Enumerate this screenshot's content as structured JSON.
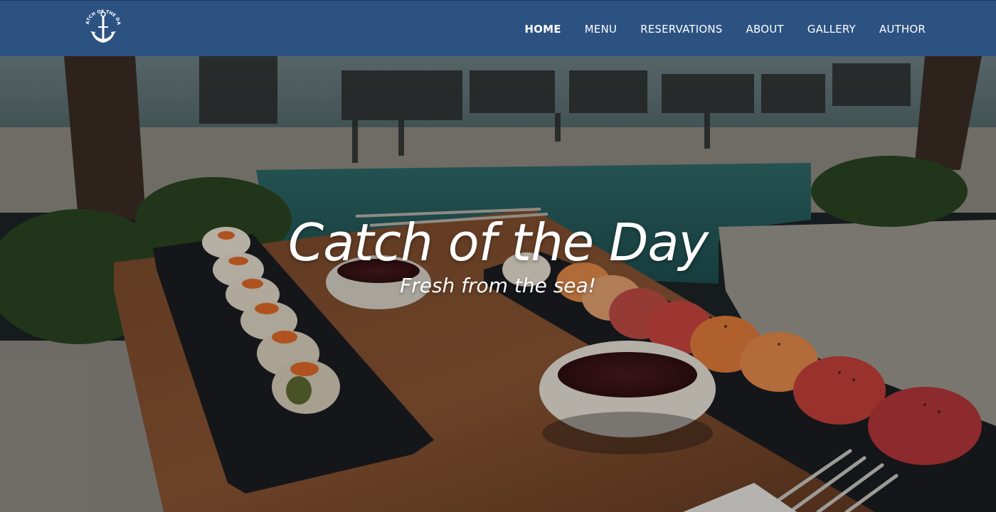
{
  "brand": {
    "logo_icon": "anchor-icon",
    "logo_text": "CATCH OF THE DAY"
  },
  "nav": {
    "items": [
      {
        "label": "HOME",
        "active": true
      },
      {
        "label": "MENU",
        "active": false
      },
      {
        "label": "RESERVATIONS",
        "active": false
      },
      {
        "label": "ABOUT",
        "active": false
      },
      {
        "label": "GALLERY",
        "active": false
      },
      {
        "label": "AUTHOR",
        "active": false
      }
    ]
  },
  "hero": {
    "title": "Catch of the Day",
    "subtitle": "Fresh from the sea!",
    "image_subject": "sushi rolls on a wooden table by a pool"
  },
  "colors": {
    "nav_bg": "#2c5282",
    "text": "#ffffff"
  }
}
